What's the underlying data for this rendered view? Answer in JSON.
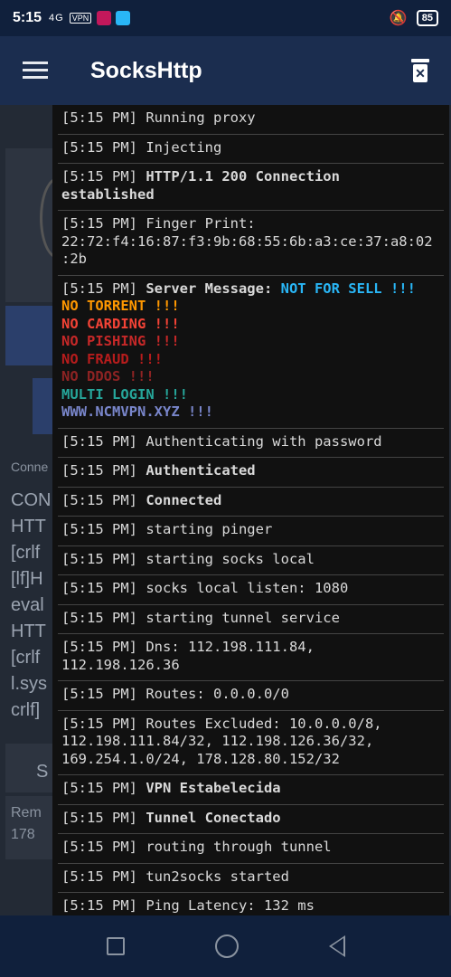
{
  "status": {
    "time": "5:15",
    "signal": "4G",
    "vpn": "VPN",
    "battery": "85"
  },
  "appbar": {
    "title": "SocksHttp",
    "menu_icon": "hamburger-menu-icon",
    "clear_icon": "trash-icon"
  },
  "background": {
    "conn_label": "Conne",
    "payload_lines": [
      "CON",
      "HTT",
      "[crlf",
      "[lf]H",
      "eval",
      "HTT",
      "[crlf",
      "l.sys",
      "crlf]"
    ],
    "s_button": "S",
    "remote_label": "Rem",
    "remote_value": "178"
  },
  "log": {
    "prefix": "[5:15 PM]",
    "entries": [
      {
        "text": "Running proxy",
        "bold": false
      },
      {
        "text": "Injecting",
        "bold": false
      },
      {
        "text": "HTTP/1.1 200 Connection established",
        "bold": true
      },
      {
        "text": "Finger Print: 22:72:f4:16:87:f3:9b:68:55:6b:a3:ce:37:a8:02:2b",
        "bold": false
      },
      {
        "text": "Server Message:",
        "bold": true,
        "server": true
      },
      {
        "text": "Authenticating with password",
        "bold": false
      },
      {
        "text": "Authenticated",
        "bold": true
      },
      {
        "text": "Connected",
        "bold": true
      },
      {
        "text": "starting pinger",
        "bold": false
      },
      {
        "text": "starting socks local",
        "bold": false
      },
      {
        "text": "socks local listen: 1080",
        "bold": false
      },
      {
        "text": "starting tunnel service",
        "bold": false
      },
      {
        "text": "Dns: 112.198.111.84, 112.198.126.36",
        "bold": false
      },
      {
        "text": "Routes: 0.0.0.0/0",
        "bold": false
      },
      {
        "text": "Routes Excluded: 10.0.0.0/8, 112.198.111.84/32, 112.198.126.36/32, 169.254.1.0/24, 178.128.80.152/32",
        "bold": false
      },
      {
        "text": "VPN Estabelecida",
        "bold": true
      },
      {
        "text": "Tunnel Conectado",
        "bold": true
      },
      {
        "text": "routing through tunnel",
        "bold": false
      },
      {
        "text": "tun2socks started",
        "bold": false
      },
      {
        "text": "Ping Latency: 132 ms",
        "bold": false
      }
    ],
    "server_message": {
      "headline": "NOT FOR SELL !!!",
      "lines": [
        {
          "text": "NO TORRENT !!!",
          "cls": "orange"
        },
        {
          "text": "NO CARDING !!!",
          "cls": "red1"
        },
        {
          "text": "NO PISHING !!!",
          "cls": "red2"
        },
        {
          "text": "NO FRAUD !!!",
          "cls": "red3"
        },
        {
          "text": "NO DDOS !!!",
          "cls": "red4"
        },
        {
          "text": "MULTI LOGIN !!!",
          "cls": "teal"
        },
        {
          "text": "WWW.NCMVPN.XYZ !!!",
          "cls": "purple"
        }
      ]
    }
  },
  "navbar": {
    "recents_icon": "square-recents-icon",
    "home_icon": "circle-home-icon",
    "back_icon": "triangle-back-icon"
  }
}
